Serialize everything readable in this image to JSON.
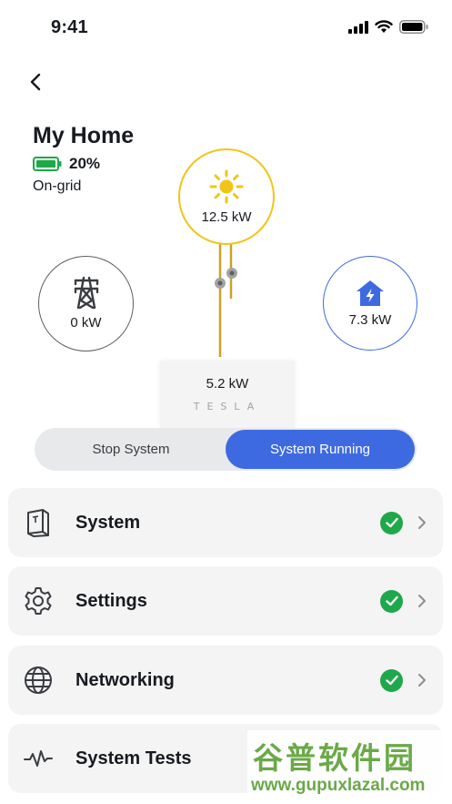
{
  "status_bar": {
    "time": "9:41"
  },
  "header": {
    "back_icon": "chevron-left-icon",
    "title": "My Home",
    "battery_percent": "20%",
    "grid_status": "On-grid"
  },
  "flow": {
    "solar": {
      "value": "12.5 kW",
      "icon": "sun-icon"
    },
    "grid": {
      "value": "0 kW",
      "icon": "transmission-tower-icon"
    },
    "home": {
      "value": "7.3 kW",
      "icon": "home-bolt-icon"
    },
    "powerwall": {
      "value": "5.2 kW",
      "logo": "TESLA"
    },
    "colors": {
      "solar": "#f2c419",
      "home": "#3e6ae1",
      "grid": "#5c5e62"
    }
  },
  "toggle": {
    "off_label": "Stop System",
    "on_label": "System Running",
    "active": "on"
  },
  "menu": {
    "items": [
      {
        "label": "System",
        "icon": "powerwall-icon",
        "status": "ok"
      },
      {
        "label": "Settings",
        "icon": "gear-icon",
        "status": "ok"
      },
      {
        "label": "Networking",
        "icon": "globe-icon",
        "status": "ok"
      },
      {
        "label": "System Tests",
        "icon": "waveform-icon",
        "status": ""
      }
    ]
  },
  "watermark": {
    "top": "谷普软件园",
    "bottom": "www.gupuxlazal.com"
  }
}
